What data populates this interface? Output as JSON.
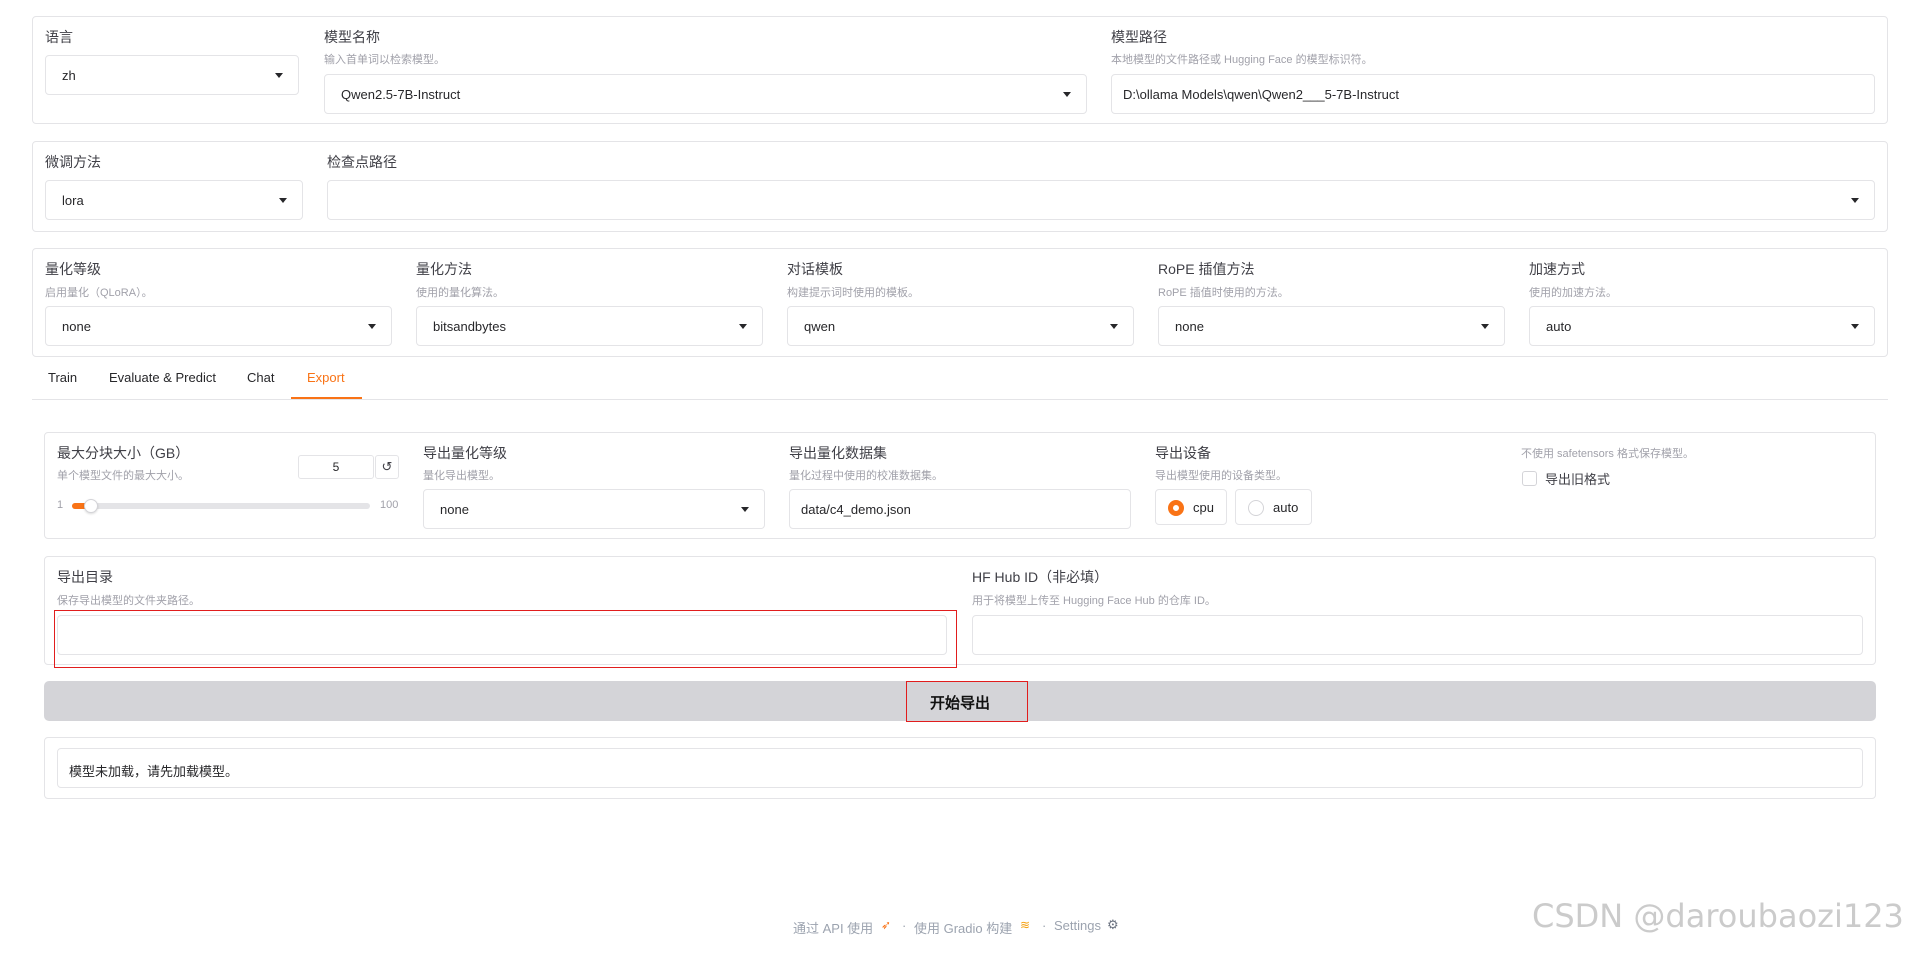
{
  "top": {
    "lang": {
      "label": "语言",
      "value": "zh"
    },
    "model_name": {
      "label": "模型名称",
      "info": "输入首单词以检索模型。",
      "value": "Qwen2.5-7B-Instruct"
    },
    "model_path": {
      "label": "模型路径",
      "info": "本地模型的文件路径或 Hugging Face 的模型标识符。",
      "value": "D:\\ollama Models\\qwen\\Qwen2___5-7B-Instruct"
    }
  },
  "finetune": {
    "method": {
      "label": "微调方法",
      "value": "lora"
    },
    "checkpoint": {
      "label": "检查点路径",
      "value": ""
    }
  },
  "advanced": {
    "quant_bit": {
      "label": "量化等级",
      "info": "启用量化（QLoRA）。",
      "value": "none"
    },
    "quant_method": {
      "label": "量化方法",
      "info": "使用的量化算法。",
      "value": "bitsandbytes"
    },
    "template": {
      "label": "对话模板",
      "info": "构建提示词时使用的模板。",
      "value": "qwen"
    },
    "rope": {
      "label": "RoPE 插值方法",
      "info": "RoPE 插值时使用的方法。",
      "value": "none"
    },
    "booster": {
      "label": "加速方式",
      "info": "使用的加速方法。",
      "value": "auto"
    }
  },
  "tabs": [
    {
      "label": "Train",
      "active": false
    },
    {
      "label": "Evaluate & Predict",
      "active": false
    },
    {
      "label": "Chat",
      "active": false
    },
    {
      "label": "Export",
      "active": true
    }
  ],
  "export": {
    "shard_size": {
      "label": "最大分块大小（GB）",
      "info": "单个模型文件的最大大小。",
      "value": "5",
      "min": "1",
      "max": "100",
      "level": 0.04,
      "reset_icon": "↺"
    },
    "export_quant": {
      "label": "导出量化等级",
      "info": "量化导出模型。",
      "value": "none"
    },
    "quant_dataset": {
      "label": "导出量化数据集",
      "info": "量化过程中使用的校准数据集。",
      "value": "data/c4_demo.json"
    },
    "device": {
      "label": "导出设备",
      "info": "导出模型使用的设备类型。",
      "options": [
        "cpu",
        "auto"
      ],
      "selected": "cpu"
    },
    "legacy": {
      "info": "不使用 safetensors 格式保存模型。",
      "label": "导出旧格式",
      "checked": false
    },
    "export_dir": {
      "label": "导出目录",
      "info": "保存导出模型的文件夹路径。",
      "value": ""
    },
    "hub_id": {
      "label": "HF Hub ID（非必填）",
      "info": "用于将模型上传至 Hugging Face Hub 的仓库 ID。",
      "value": ""
    },
    "start_button": "开始导出",
    "output": "模型未加载，请先加载模型。"
  },
  "footer": {
    "api": "通过 API 使用",
    "api_icon": "rocket-icon",
    "sep1": "·",
    "gradio": "使用 Gradio 构建",
    "gradio_icon": "gradio-logo-icon",
    "sep2": "·",
    "settings": "Settings",
    "settings_icon": "gear-icon"
  },
  "watermark": "CSDN @daroubaozi123",
  "colors": {
    "accent": "#f97316",
    "highlight_box": "#e11d1d",
    "button_bg": "#d4d4d8"
  }
}
